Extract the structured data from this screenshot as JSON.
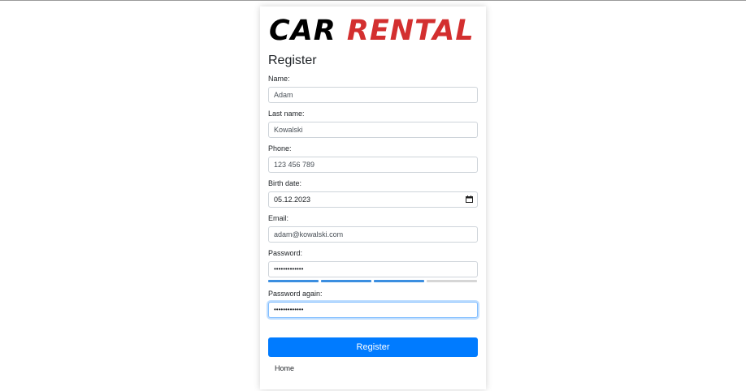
{
  "logo": {
    "word1": "CAR",
    "word2": "RENTAL"
  },
  "form": {
    "title": "Register",
    "name": {
      "label": "Name:",
      "value": "Adam"
    },
    "last_name": {
      "label": "Last name:",
      "value": "Kowalski"
    },
    "phone": {
      "label": "Phone:",
      "value": "123 456 789"
    },
    "birth_date": {
      "label": "Birth date:",
      "value": "05.12.2023"
    },
    "email": {
      "label": "Email:",
      "value": "adam@kowalski.com"
    },
    "password": {
      "label": "Password:",
      "value": "•••••••••••••"
    },
    "password_again": {
      "label": "Password again:",
      "value": "•••••••••••••"
    },
    "password_strength": {
      "filled_segments": 3,
      "total_segments": 4
    },
    "submit_label": "Register"
  },
  "footer": {
    "home_link": "Home"
  },
  "colors": {
    "brand_red": "#d32f2f",
    "primary": "#007bff",
    "strength_filled": "#3b8ee0",
    "strength_empty": "#d6d6d6"
  },
  "icons": {
    "birth_date_picker": "calendar-icon"
  }
}
